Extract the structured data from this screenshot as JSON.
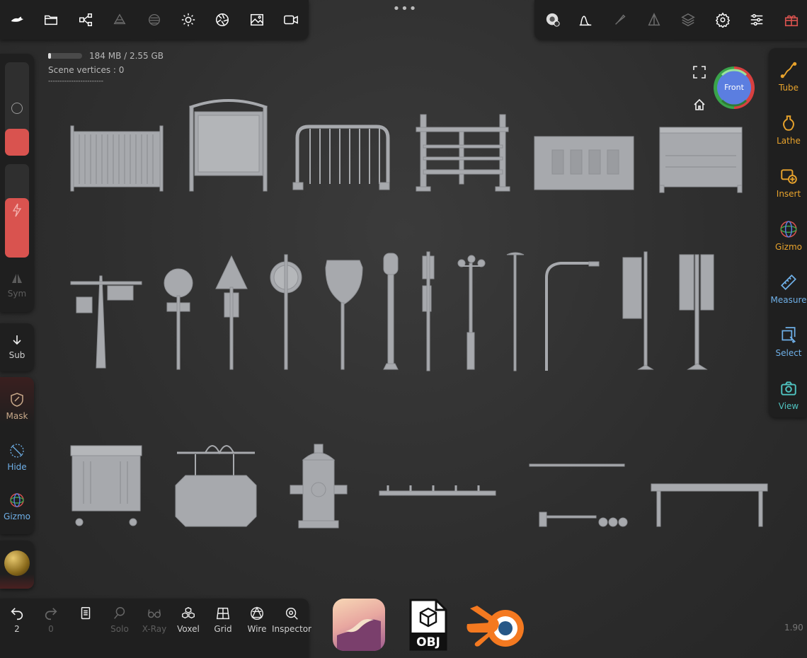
{
  "top_toolbar": {
    "left_icons": [
      "brand-logo-icon",
      "folder-icon",
      "share-nodes-icon",
      "spray-icon",
      "texture-icon",
      "sun-icon",
      "aperture-icon",
      "image-icon",
      "video-icon"
    ],
    "center_handle": "•••",
    "right_icons": [
      "material-settings-icon",
      "curve-icon",
      "brush-icon",
      "pyramid-icon",
      "layers-icon",
      "gear-icon",
      "sliders-icon",
      "gift-icon"
    ]
  },
  "hud": {
    "memory": "184 MB / 2.55 GB",
    "scene_vertices": "Scene vertices : 0",
    "separator": "------------------------",
    "version": "1.90"
  },
  "view_cube": {
    "label": "Front"
  },
  "left_panel": {
    "sym": "Sym",
    "sub": "Sub",
    "mask": "Mask",
    "hide": "Hide",
    "gizmo": "Gizmo"
  },
  "right_panel": {
    "tools": [
      {
        "label": "Tube",
        "icon": "tube-icon"
      },
      {
        "label": "Lathe",
        "icon": "lathe-icon"
      },
      {
        "label": "Insert",
        "icon": "insert-icon"
      },
      {
        "label": "Gizmo",
        "icon": "gizmo-icon"
      },
      {
        "label": "Measure",
        "icon": "ruler-icon"
      },
      {
        "label": "Select",
        "icon": "select-icon"
      },
      {
        "label": "View",
        "icon": "camera-icon"
      }
    ]
  },
  "bottom_toolbar": {
    "undo_count": "2",
    "redo_count": "0",
    "tools": [
      {
        "label": "Solo"
      },
      {
        "label": "X-Ray"
      },
      {
        "label": "Voxel"
      },
      {
        "label": "Grid"
      },
      {
        "label": "Wire"
      },
      {
        "label": "Inspector"
      }
    ]
  },
  "apps": {
    "obj_label": "OBJ"
  },
  "colors": {
    "accent_orange": "#e8a32c",
    "accent_red": "#d9534f",
    "accent_blue": "#6fb0e8",
    "panel_bg": "#1f1f1f",
    "asset_gray": "#a7a9ad"
  }
}
